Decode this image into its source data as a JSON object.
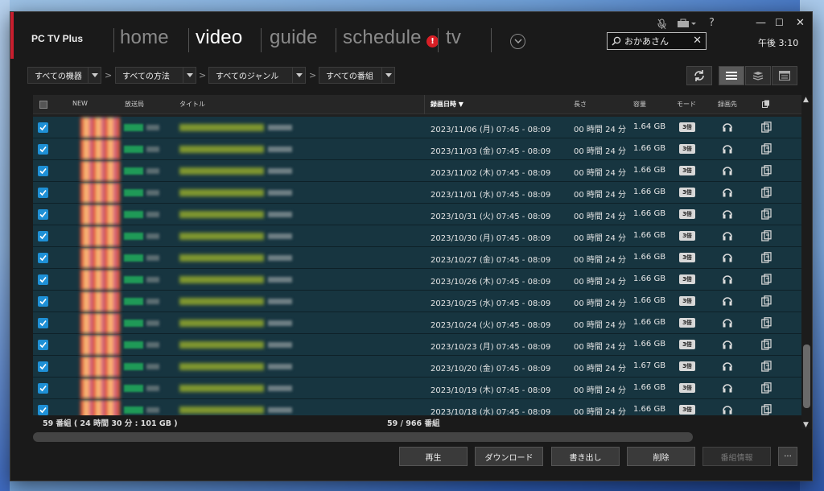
{
  "app": {
    "title": "PC TV Plus"
  },
  "nav": {
    "tabs": [
      {
        "label": "home",
        "active": false
      },
      {
        "label": "video",
        "active": true
      },
      {
        "label": "guide",
        "active": false
      },
      {
        "label": "schedule",
        "active": false
      },
      {
        "label": "tv",
        "active": false
      }
    ],
    "schedule_alert": "!"
  },
  "search": {
    "value": "おかあさん",
    "clear": "✕"
  },
  "clock": "午後 3:10",
  "top_icons": {
    "help": "?"
  },
  "window_buttons": {
    "minimize": "—",
    "maximize": "☐",
    "close": "✕"
  },
  "filters": [
    {
      "label": "すべての機器"
    },
    {
      "label": "すべての方法"
    },
    {
      "label": "すべてのジャンル"
    },
    {
      "label": "すべての番組"
    }
  ],
  "filter_sep": ">",
  "columns": {
    "new": "NEW",
    "channel": "放送局",
    "title": "タイトル",
    "datetime": "録画日時 ▼",
    "length": "長さ",
    "size": "容量",
    "mode": "モード",
    "destination": "録画先"
  },
  "rows": [
    {
      "datetime": "2023/11/06 (月) 07:45 - 08:09",
      "length": "00 時間 24 分",
      "size": "1.64 GB",
      "mode": "3倍"
    },
    {
      "datetime": "2023/11/03 (金) 07:45 - 08:09",
      "length": "00 時間 24 分",
      "size": "1.66 GB",
      "mode": "3倍"
    },
    {
      "datetime": "2023/11/02 (木) 07:45 - 08:09",
      "length": "00 時間 24 分",
      "size": "1.66 GB",
      "mode": "3倍"
    },
    {
      "datetime": "2023/11/01 (水) 07:45 - 08:09",
      "length": "00 時間 24 分",
      "size": "1.66 GB",
      "mode": "3倍"
    },
    {
      "datetime": "2023/10/31 (火) 07:45 - 08:09",
      "length": "00 時間 24 分",
      "size": "1.66 GB",
      "mode": "3倍"
    },
    {
      "datetime": "2023/10/30 (月) 07:45 - 08:09",
      "length": "00 時間 24 分",
      "size": "1.66 GB",
      "mode": "3倍"
    },
    {
      "datetime": "2023/10/27 (金) 07:45 - 08:09",
      "length": "00 時間 24 分",
      "size": "1.66 GB",
      "mode": "3倍"
    },
    {
      "datetime": "2023/10/26 (木) 07:45 - 08:09",
      "length": "00 時間 24 分",
      "size": "1.66 GB",
      "mode": "3倍"
    },
    {
      "datetime": "2023/10/25 (水) 07:45 - 08:09",
      "length": "00 時間 24 分",
      "size": "1.66 GB",
      "mode": "3倍"
    },
    {
      "datetime": "2023/10/24 (火) 07:45 - 08:09",
      "length": "00 時間 24 分",
      "size": "1.66 GB",
      "mode": "3倍"
    },
    {
      "datetime": "2023/10/23 (月) 07:45 - 08:09",
      "length": "00 時間 24 分",
      "size": "1.66 GB",
      "mode": "3倍"
    },
    {
      "datetime": "2023/10/20 (金) 07:45 - 08:09",
      "length": "00 時間 24 分",
      "size": "1.67 GB",
      "mode": "3倍"
    },
    {
      "datetime": "2023/10/19 (木) 07:45 - 08:09",
      "length": "00 時間 24 分",
      "size": "1.66 GB",
      "mode": "3倍"
    },
    {
      "datetime": "2023/10/18 (水) 07:45 - 08:09",
      "length": "00 時間 24 分",
      "size": "1.66 GB",
      "mode": "3倍"
    }
  ],
  "footer": {
    "summary": "59 番組 ( 24 時間 30 分 : 101 GB )",
    "selection": "59 / 966 番組"
  },
  "actions": {
    "play": "再生",
    "download": "ダウンロード",
    "export": "書き出し",
    "delete": "削除",
    "info": "番組情報",
    "more": "···"
  },
  "colors": {
    "accent": "#c81e2e",
    "row_bg": "#173540",
    "checkbox": "#1e90d6",
    "alert": "#d81f26"
  }
}
